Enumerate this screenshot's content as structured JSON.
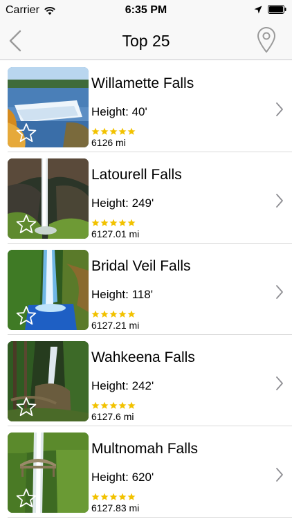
{
  "status_bar": {
    "carrier": "Carrier",
    "time": "6:35 PM"
  },
  "nav": {
    "title": "Top 25",
    "back_icon": "chevron-left-icon",
    "right_icon": "location-pin-icon"
  },
  "colors": {
    "star_rating": "#f2c200",
    "separator": "#d9d9d9",
    "chevron": "#8e8e93",
    "nav_tint": "#9a9a9a"
  },
  "falls": [
    {
      "name": "Willamette Falls",
      "height": "Height: 40'",
      "rating": 5,
      "distance": "6126 mi"
    },
    {
      "name": "Latourell Falls",
      "height": "Height: 249'",
      "rating": 5,
      "distance": "6127.01 mi"
    },
    {
      "name": "Bridal Veil Falls",
      "height": "Height: 118'",
      "rating": 5,
      "distance": "6127.21 mi"
    },
    {
      "name": "Wahkeena Falls",
      "height": "Height: 242'",
      "rating": 5,
      "distance": "6127.6 mi"
    },
    {
      "name": "Multnomah Falls",
      "height": "Height: 620'",
      "rating": 5,
      "distance": "6127.83 mi"
    }
  ]
}
